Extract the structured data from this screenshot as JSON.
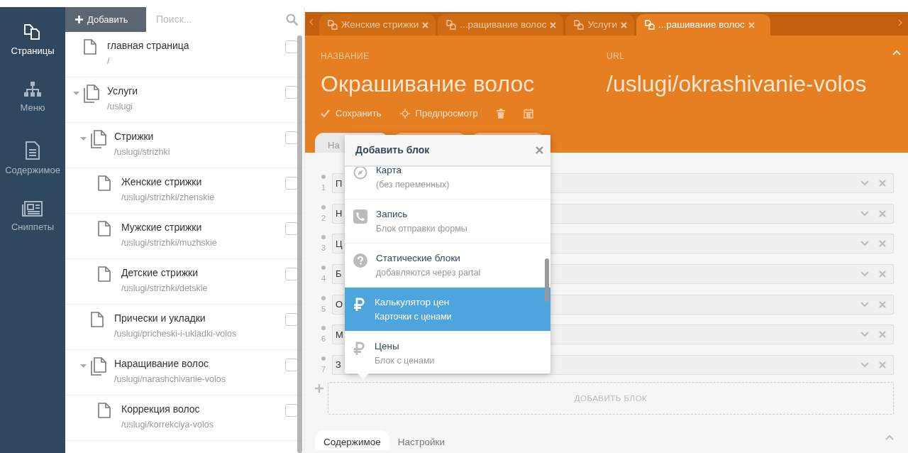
{
  "nav": [
    {
      "label": "Страницы",
      "selected": true
    },
    {
      "label": "Меню",
      "selected": false
    },
    {
      "label": "Содержимое",
      "selected": false
    },
    {
      "label": "Сниппеты",
      "selected": false
    }
  ],
  "tree_panel": {
    "add_button": "Добавить",
    "search": {
      "placeholder": "Поиск..."
    },
    "items": [
      {
        "title": "главная страница",
        "url": "/",
        "checked": false
      },
      {
        "title": "Услуги",
        "url": "/uslugi",
        "checked": false,
        "expanded": true,
        "children": [
          {
            "title": "Стрижки",
            "url": "/uslugi/strizhki",
            "checked": false,
            "expanded": true,
            "children": [
              {
                "title": "Женские стрижки",
                "url": "/uslugi/strizhki/zhenskie",
                "checked": false
              },
              {
                "title": "Мужские стрижки",
                "url": "/uslugi/strizhki/muzhskie",
                "checked": false
              },
              {
                "title": "Детские стрижки",
                "url": "/uslugi/strizhki/detskie",
                "checked": false
              }
            ]
          },
          {
            "title": "Прически и укладки",
            "url": "/uslugi/pricheski-i-ukladki-volos",
            "checked": false
          },
          {
            "title": "Наращивание волос",
            "url": "/uslugi/narashchivanie-volos",
            "checked": false,
            "expanded": true,
            "children": [
              {
                "title": "Коррекция волос",
                "url": "/uslugi/korrekciya-volos",
                "checked": false
              }
            ]
          }
        ]
      }
    ]
  },
  "editor_tabs": [
    {
      "label": "Женские стрижки",
      "selected": false
    },
    {
      "label": "...ращивание волос",
      "selected": false
    },
    {
      "label": "Услуги",
      "selected": false
    },
    {
      "label": "...рашивание волос",
      "selected": true
    }
  ],
  "page_header": {
    "name_label": "НАЗВАНИЕ",
    "name": "Окрашивание волос",
    "url_label": "URL",
    "url": "/uslugi/okrashivanie-volos",
    "actions": [
      {
        "kind": "save",
        "label": "Сохранить"
      },
      {
        "kind": "preview",
        "label": "Предпросмотр"
      },
      {
        "kind": "delete"
      },
      {
        "kind": "schedule"
      }
    ]
  },
  "section_tabs": [
    {
      "label": "На",
      "selected": true
    },
    {
      "selected": false
    },
    {
      "selected": false
    }
  ],
  "blocks": [
    {
      "number": "1",
      "label": "П"
    },
    {
      "number": "2",
      "label": "Н"
    },
    {
      "number": "3",
      "label": "Ц"
    },
    {
      "number": "4",
      "label": "Б"
    },
    {
      "number": "5",
      "label": "О"
    },
    {
      "number": "6",
      "label": "М"
    },
    {
      "number": "7",
      "label": "З"
    }
  ],
  "add_block_button": "ДОБАВИТЬ БЛОК",
  "bottom_tabs": [
    {
      "label": "Содержимое",
      "selected": true
    },
    {
      "label": "Настройки",
      "selected": false
    }
  ],
  "add_block_popup": {
    "title": "Добавить блок",
    "items": [
      {
        "title": "Карта",
        "subtitle": "(без переменных)",
        "selected": false
      },
      {
        "title": "Запись",
        "subtitle": "Блок отправки формы",
        "selected": false
      },
      {
        "title": "Статические блоки",
        "subtitle": "добавляются через partal",
        "selected": false
      },
      {
        "title": "Калькулятор цен",
        "subtitle": "Карточки с ценами",
        "selected": true
      },
      {
        "title": "Цены",
        "subtitle": "Блок с ценами",
        "selected": false
      }
    ]
  }
}
